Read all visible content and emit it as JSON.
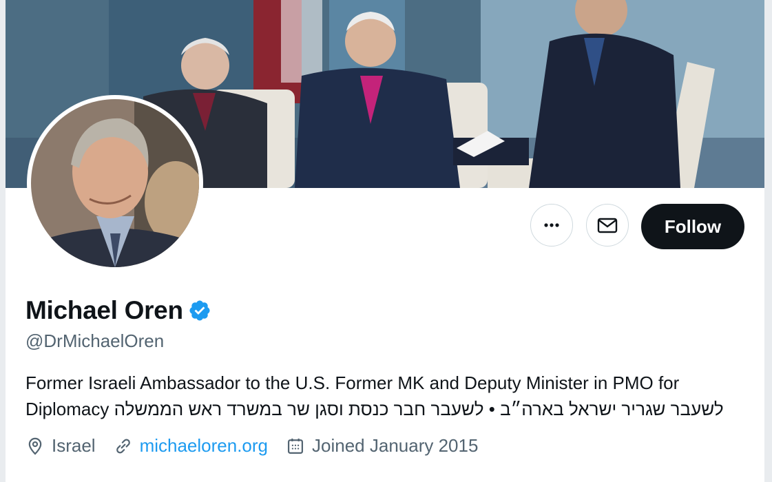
{
  "profile": {
    "display_name": "Michael Oren",
    "handle": "@DrMichaelOren",
    "bio_english": "Former Israeli Ambassador to the U.S. Former MK and Deputy Minister in PMO for Diplomacy",
    "bio_hebrew": "לשעבר שגריר ישראל בארה״ב • לשעבר חבר כנסת וסגן שר במשרד ראש הממשלה",
    "location": "Israel",
    "website": "michaeloren.org",
    "joined": "Joined January 2015"
  },
  "actions": {
    "more_icon": "more-dots-icon",
    "message_icon": "envelope-icon",
    "follow_label": "Follow"
  },
  "stats": {
    "following": "",
    "followers": ""
  },
  "colors": {
    "verified": "#1d9bf0",
    "link": "#1d9bf0",
    "follow_bg": "#0f1419",
    "secondary_text": "#536471"
  }
}
